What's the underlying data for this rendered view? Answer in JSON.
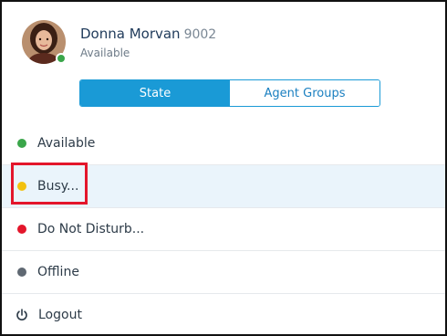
{
  "user": {
    "name": "Donna Morvan",
    "extension": "9002",
    "status": "Available",
    "status_color": "#3aa64a"
  },
  "tabs": [
    {
      "label": "State",
      "active": true
    },
    {
      "label": "Agent Groups",
      "active": false
    }
  ],
  "states": [
    {
      "label": "Available",
      "color": "#3aa64a",
      "icon": "status-dot"
    },
    {
      "label": "Busy...",
      "color": "#f2c10f",
      "icon": "status-dot",
      "selected": true
    },
    {
      "label": "Do Not Disturb...",
      "color": "#e3162b",
      "icon": "status-dot"
    },
    {
      "label": "Offline",
      "color": "#5f6872",
      "icon": "status-dot"
    },
    {
      "label": "Logout",
      "icon": "power-icon"
    }
  ],
  "highlight": {
    "color": "#e3162b",
    "target": "Busy..."
  }
}
